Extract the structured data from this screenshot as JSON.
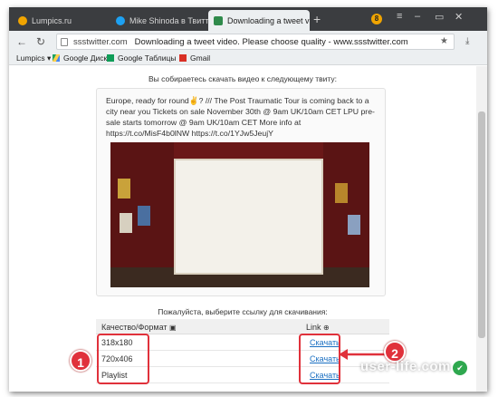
{
  "tabs": [
    {
      "label": "Lumpics.ru",
      "color": "#f0a400"
    },
    {
      "label": "Mike Shinoda в Твиттере",
      "color": "#1da1f2"
    },
    {
      "label": "Downloading a tweet video",
      "color": "#2f8a4b"
    }
  ],
  "address": {
    "domain": "ssstwitter.com",
    "title": "Downloading a tweet video. Please choose quality - www.ssstwitter.com"
  },
  "bookmarks": [
    "Lumpics ▾",
    "Google Диск",
    "Google Таблицы",
    "Gmail"
  ],
  "page": {
    "intro": "Вы собираетесь скачать видео к следующему твиту:",
    "tweet_text": "Europe, ready for round✌? /// The Post Traumatic Tour is coming back to a city near you Tickets on sale November 30th @ 9am UK/10am CET   LPU pre-sale starts tomorrow @ 9am UK/10am CET More info at https://t.co/MisF4b0lNW https://t.co/1YJw5JeujY",
    "choose_label": "Пожалуйста, выберите ссылку для скачивания:",
    "col_quality": "Качество/Формат",
    "col_link": "Link",
    "rows": [
      {
        "quality": "318x180",
        "link": "Скачать"
      },
      {
        "quality": "720x406",
        "link": "Скачать"
      },
      {
        "quality": "Playlist",
        "link": "Скачать"
      }
    ]
  },
  "annotations": {
    "marker1": "1",
    "marker2": "2"
  },
  "watermark": "user-life.com",
  "colors": {
    "accent_red": "#e0313b",
    "link_blue": "#1a6fc2",
    "video_bg": "#6a1818"
  }
}
